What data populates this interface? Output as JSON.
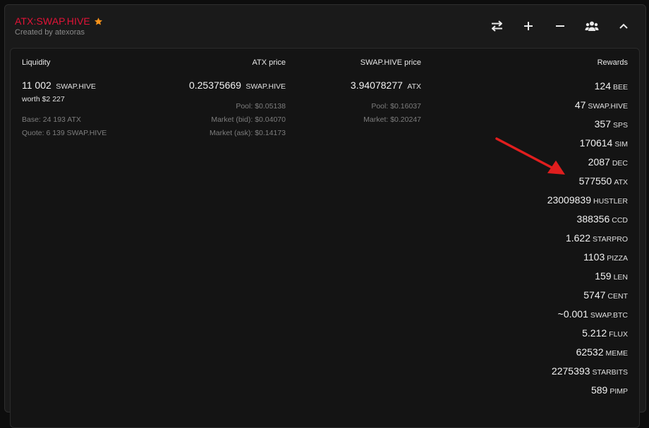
{
  "header": {
    "title": "ATX:SWAP.HIVE",
    "subtitle": "Created by atexoras",
    "star_color": "#f7931a",
    "title_color": "#e31337"
  },
  "toolbar": {
    "icons": [
      "swap-arrows-icon",
      "plus-icon",
      "minus-icon",
      "users-icon",
      "chevron-up-icon"
    ]
  },
  "liquidity": {
    "heading": "Liquidity",
    "amount": "11 002",
    "amount_unit": "SWAP.HIVE",
    "worth": "worth $2 227",
    "base": "Base: 24 193 ATX",
    "quote": "Quote: 6 139 SWAP.HIVE"
  },
  "atx_price": {
    "heading": "ATX price",
    "value": "0.25375669",
    "unit": "SWAP.HIVE",
    "pool": "Pool: $0.05138",
    "market_bid": "Market (bid): $0.04070",
    "market_ask": "Market (ask): $0.14173"
  },
  "swap_hive_price": {
    "heading": "SWAP.HIVE price",
    "value": "3.94078277",
    "unit": "ATX",
    "pool": "Pool: $0.16037",
    "market": "Market: $0.20247"
  },
  "rewards": {
    "heading": "Rewards",
    "items": [
      {
        "amount": "124",
        "token": "BEE"
      },
      {
        "amount": "47",
        "token": "SWAP.HIVE"
      },
      {
        "amount": "357",
        "token": "SPS"
      },
      {
        "amount": "170614",
        "token": "SIM"
      },
      {
        "amount": "2087",
        "token": "DEC"
      },
      {
        "amount": "577550",
        "token": "ATX"
      },
      {
        "amount": "23009839",
        "token": "HUSTLER"
      },
      {
        "amount": "388356",
        "token": "CCD"
      },
      {
        "amount": "1.622",
        "token": "STARPRO"
      },
      {
        "amount": "1103",
        "token": "PIZZA"
      },
      {
        "amount": "159",
        "token": "LEN"
      },
      {
        "amount": "5747",
        "token": "CENT"
      },
      {
        "amount": "~0.001",
        "token": "SWAP.BTC"
      },
      {
        "amount": "5.212",
        "token": "FLUX"
      },
      {
        "amount": "62532",
        "token": "MEME"
      },
      {
        "amount": "2275393",
        "token": "STARBITS"
      },
      {
        "amount": "589",
        "token": "PIMP"
      }
    ]
  },
  "annotation": {
    "arrow_color": "#e01e1e"
  }
}
